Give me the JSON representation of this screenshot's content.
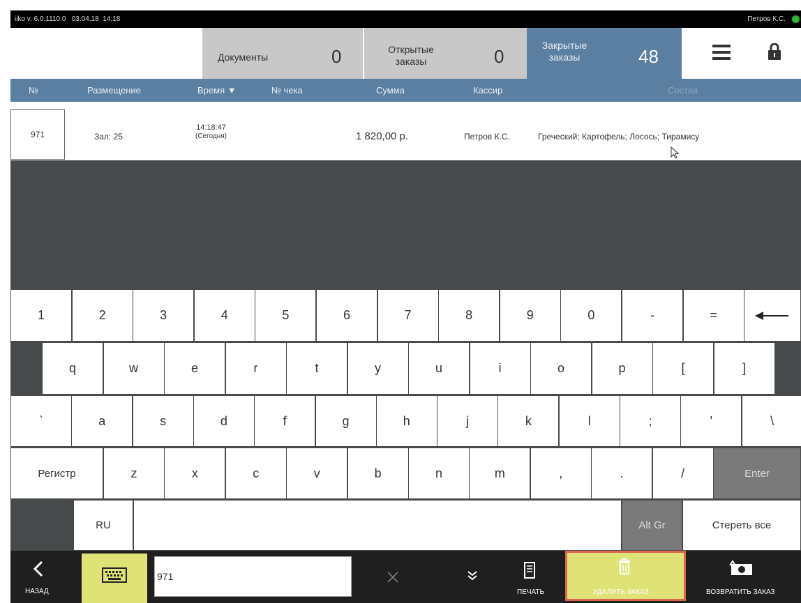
{
  "status_bar": {
    "version": "iiko v. 6.0.1110.0",
    "date": "03.04.18",
    "time": "14:18",
    "user": "Петров К.С."
  },
  "tabs": {
    "documents": {
      "label": "Документы",
      "count": "0"
    },
    "open_orders": {
      "label": "Открытые заказы",
      "count": "0"
    },
    "closed_orders": {
      "label": "Закрытые заказы",
      "count": "48"
    }
  },
  "columns": {
    "number": "№",
    "placement": "Размещение",
    "time": "Время ▼",
    "receipt": "№ чека",
    "sum": "Сумма",
    "cashier": "Кассир",
    "contents": "Состав"
  },
  "order_row": {
    "number": "971",
    "placement": "Зал: 25",
    "time": "14:18:47",
    "day": "(Сегодня)",
    "sum": "1 820,00 р.",
    "cashier": "Петров К.С.",
    "contents": "Греческий; Картофель; Лосось; Тирамису"
  },
  "keyboard": {
    "row1": [
      "1",
      "2",
      "3",
      "4",
      "5",
      "6",
      "7",
      "8",
      "9",
      "0",
      "-",
      "="
    ],
    "row2": [
      "q",
      "w",
      "e",
      "r",
      "t",
      "y",
      "u",
      "i",
      "o",
      "p",
      "[",
      "]"
    ],
    "row3": [
      "`",
      "a",
      "s",
      "d",
      "f",
      "g",
      "h",
      "j",
      "k",
      "l",
      ";",
      "'",
      "\\"
    ],
    "row4": [
      "z",
      "x",
      "c",
      "v",
      "b",
      "n",
      "m",
      ",",
      ".",
      "/"
    ],
    "shift": "Регистр",
    "enter": "Enter",
    "lang": "RU",
    "altgr": "Alt Gr",
    "clear_all": "Стереть все"
  },
  "bottom": {
    "back": "НАЗАД",
    "search_value": "971",
    "print": "ПЕЧАТЬ",
    "delete": "УДАЛИТЬ ЗАКАЗ",
    "return": "ВОЗВРАТИТЬ ЗАКАЗ"
  },
  "colors": {
    "header": "#5b7fa1",
    "active_tab": "#5b7fa1",
    "inactive_tab": "#c8c8c8",
    "dark": "#464a4b",
    "delete_bg": "#dfe277",
    "delete_border": "#d9674b",
    "keyboard_btn": "#dfe277"
  }
}
